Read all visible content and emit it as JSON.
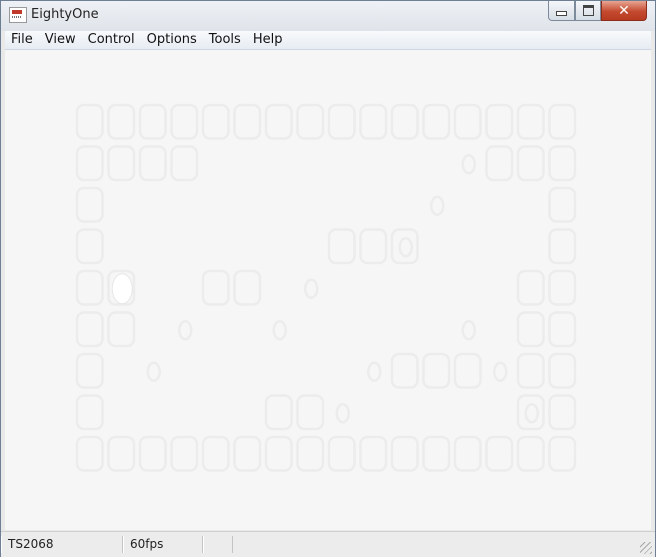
{
  "window": {
    "title": "EightyOne",
    "icon": "zx81-app-icon",
    "controls": {
      "minimize": "minimize-icon",
      "maximize": "maximize-icon",
      "close": "close-icon"
    }
  },
  "menu": [
    {
      "label": "File"
    },
    {
      "label": "View"
    },
    {
      "label": "Control"
    },
    {
      "label": "Options"
    },
    {
      "label": "Tools"
    },
    {
      "label": "Help"
    }
  ],
  "status": {
    "device": "TS2068",
    "fps": "60fps",
    "extra": ""
  },
  "colors": {
    "screen_bg": "#f6f6f6",
    "maze": "#ececec",
    "titlebar": "#e3e8ee",
    "close": "#c44a2f"
  }
}
